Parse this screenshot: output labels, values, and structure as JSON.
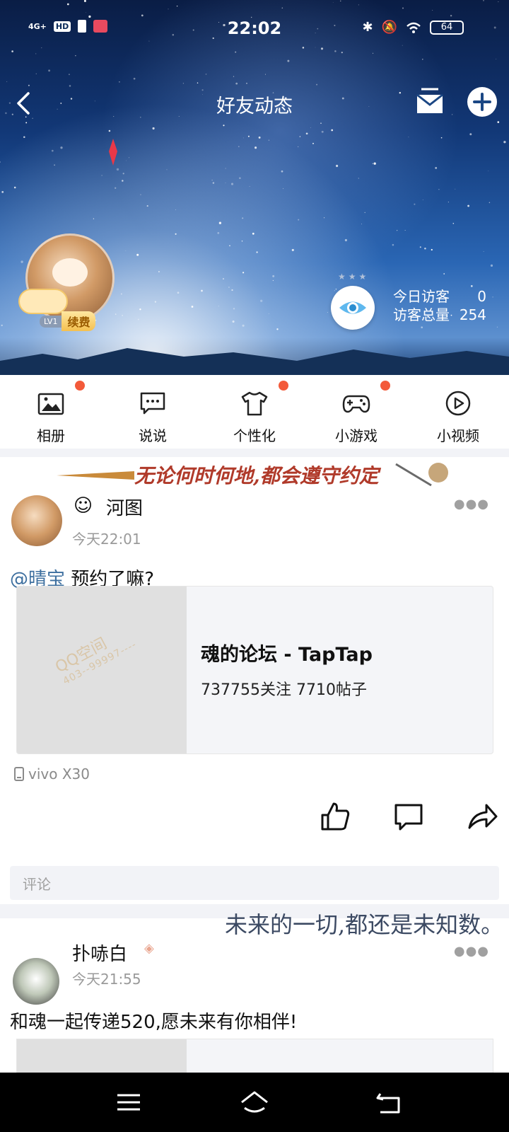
{
  "status_bar": {
    "network": "4G+",
    "hd": "HD",
    "time": "22:02",
    "battery": "64"
  },
  "header": {
    "title": "好友动态",
    "user": {
      "level": "LV1",
      "renew_label": "续费"
    },
    "visitors": {
      "today_label": "今日访客",
      "today_value": "0",
      "total_label": "访客总量",
      "total_value": "254"
    }
  },
  "shortcuts": [
    {
      "label": "相册",
      "icon": "photo-album-icon",
      "badge": true
    },
    {
      "label": "说说",
      "icon": "chat-bubble-icon",
      "badge": false
    },
    {
      "label": "个性化",
      "icon": "tshirt-icon",
      "badge": true
    },
    {
      "label": "小游戏",
      "icon": "gamepad-icon",
      "badge": true
    },
    {
      "label": "小视频",
      "icon": "play-circle-icon",
      "badge": false
    }
  ],
  "posts": [
    {
      "decoration": "无论何时何地,都会遵守约定",
      "name": "河图",
      "time": "今天22:01",
      "mention": "@晴宝",
      "text": " 预约了嘛?",
      "link": {
        "title": "魂的论坛 - TapTap",
        "subtitle": "737755关注 7710帖子",
        "watermark_brand": "QQ空间",
        "watermark_id": "403--99997----"
      },
      "device": "vivo X30",
      "comment_placeholder": "评论"
    },
    {
      "decoration": "未来的一切,都还是未知数。",
      "name": "扑哧白",
      "time": "今天21:55",
      "text": "和魂一起传递520,愿未来有你相伴!"
    }
  ],
  "colors": {
    "accent_red": "#f35a3a",
    "mention_blue": "#3d6f9f",
    "sky_dark": "#0a1d45"
  }
}
